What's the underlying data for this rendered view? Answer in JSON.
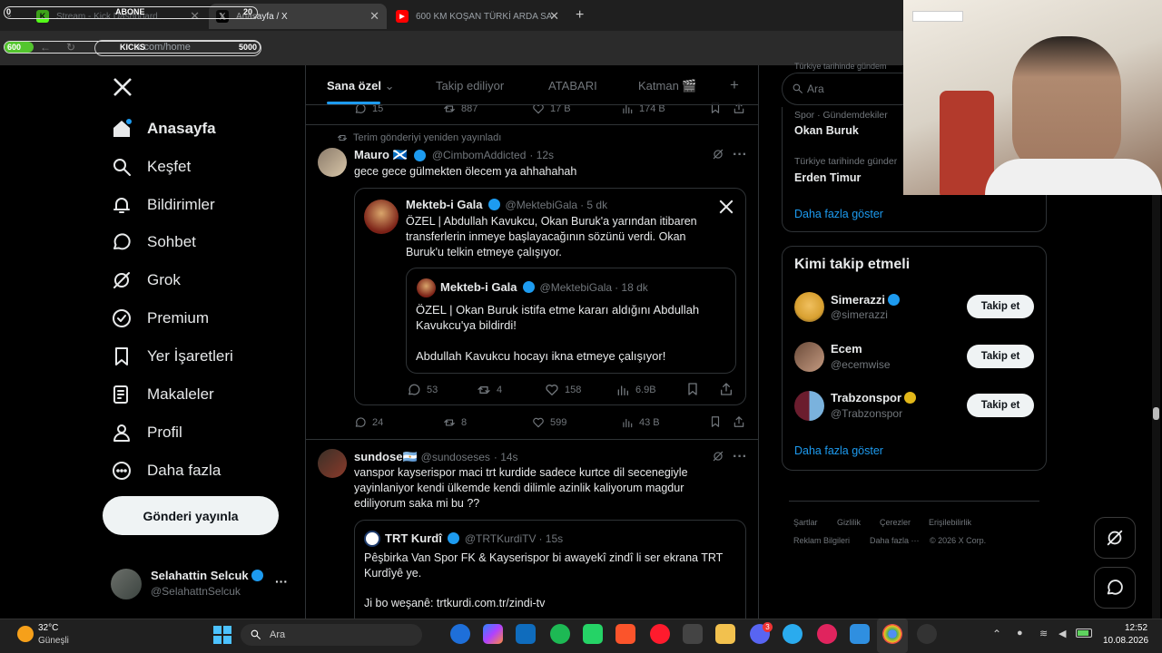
{
  "browser": {
    "tabs": [
      {
        "title": "Stream - Kick Dashboard",
        "active": false
      },
      {
        "title": "Anasayfa / X",
        "active": true
      },
      {
        "title": "600 KM KOŞAN TÜRKİ ARDA SA",
        "active": false
      }
    ],
    "url": "x.com/home",
    "overlay": {
      "abone_label": "ABONE",
      "abone_left": "0",
      "abone_right": "20",
      "kicks_label": "KICKS",
      "kicks_left": "600",
      "kicks_right": "5000"
    }
  },
  "nav": {
    "items": [
      {
        "label": "Anasayfa",
        "icon": "home-icon"
      },
      {
        "label": "Keşfet",
        "icon": "search-icon"
      },
      {
        "label": "Bildirimler",
        "icon": "bell-icon"
      },
      {
        "label": "Sohbet",
        "icon": "chat-icon"
      },
      {
        "label": "Grok",
        "icon": "grok-icon"
      },
      {
        "label": "Premium",
        "icon": "premium-icon"
      },
      {
        "label": "Yer İşaretleri",
        "icon": "bookmark-icon"
      },
      {
        "label": "Makaleler",
        "icon": "article-icon"
      },
      {
        "label": "Profil",
        "icon": "person-icon"
      },
      {
        "label": "Daha fazla",
        "icon": "more-icon"
      }
    ],
    "post_button": "Gönderi yayınla",
    "user": {
      "name": "Selahattin Selcuk",
      "handle": "@SelahattnSelcuk"
    }
  },
  "feed": {
    "tabs": [
      "Sana özel",
      "Takip ediliyor",
      "ATABARI",
      "Katman 🎬"
    ],
    "prev_actions": {
      "replies": "15",
      "reposts": "887",
      "likes": "17 B",
      "views": "174 B"
    },
    "post1": {
      "repost_note": "Terim gönderiyi yeniden yayınladı",
      "name": "Mauro 🏴󠁧󠁢󠁳󠁣󠁴󠁿",
      "handle": "@CimbomAddicted",
      "time": "· 12s",
      "text": "gece gece gülmekten ölecem ya ahhahahah",
      "quote": {
        "name": "Mekteb-i Gala",
        "handle": "@MektebiGala",
        "time": "· 5 dk",
        "text": "ÖZEL | Abdullah Kavukcu, Okan Buruk'a yarından itibaren transferlerin inmeye başlayacağının sözünü verdi. Okan Buruk'u telkin etmeye çalışıyor.",
        "inner": {
          "name": "Mekteb-i Gala",
          "handle": "@MektebiGala",
          "time": "· 18 dk",
          "text1": "ÖZEL | Okan Buruk istifa etme kararı aldığını Abdullah Kavukcu'ya bildirdi!",
          "text2": "Abdullah Kavukcu hocayı ikna etmeye çalışıyor!"
        },
        "actions": {
          "replies": "53",
          "reposts": "4",
          "likes": "158",
          "views": "6.9B"
        }
      },
      "actions": {
        "replies": "24",
        "reposts": "8",
        "likes": "599",
        "views": "43 B"
      }
    },
    "post2": {
      "name": "sundose🇦🇷",
      "handle": "@sundoseses",
      "time": "· 14s",
      "text": "vanspor kayserispor maci trt kurdide sadece kurtce dil secenegiyle yayinlaniyor kendi ülkemde kendi dilimle azinlik kaliyorum magdur ediliyorum saka mi bu ??",
      "quote": {
        "name": "TRT Kurdî",
        "handle": "@TRTKurdiTV",
        "time": "· 15s",
        "text1": "Pêşbirka Van Spor FK & Kayserispor bi awayekî zindî li ser ekrana TRT Kurdîyê ye.",
        "text2": "Ji bo weşanê: trtkurdi.com.tr/zindi-tv"
      }
    }
  },
  "right": {
    "search_placeholder": "Ara",
    "cut_text": "Türkiye tarihinde gündem",
    "trends": [
      {
        "meta": "Spor · Gündemdekiler",
        "title": "Okan Buruk"
      },
      {
        "meta": "Türkiye tarihinde günder",
        "title": "Erden Timur"
      }
    ],
    "show_more": "Daha fazla göster",
    "follow_title": "Kimi takip etmeli",
    "follow": [
      {
        "name": "Simerazzi",
        "handle": "@simerazzi",
        "badge": "blue"
      },
      {
        "name": "Ecem",
        "handle": "@ecemwise",
        "badge": "none"
      },
      {
        "name": "Trabzonspor",
        "handle": "@Trabzonspor",
        "badge": "gold"
      }
    ],
    "follow_button": "Takip et",
    "show_more2": "Daha fazla göster",
    "footer": [
      "Şartlar",
      "Gizlilik",
      "Çerezler",
      "Erişilebilirlik",
      "Reklam Bilgileri",
      "Daha fazla ···",
      "© 2026 X Corp."
    ]
  },
  "taskbar": {
    "weather_temp": "32°C",
    "weather_desc": "Güneşli",
    "search": "Ara",
    "time": "12:52",
    "date": "10.08.2026",
    "discord_badge": "3"
  }
}
